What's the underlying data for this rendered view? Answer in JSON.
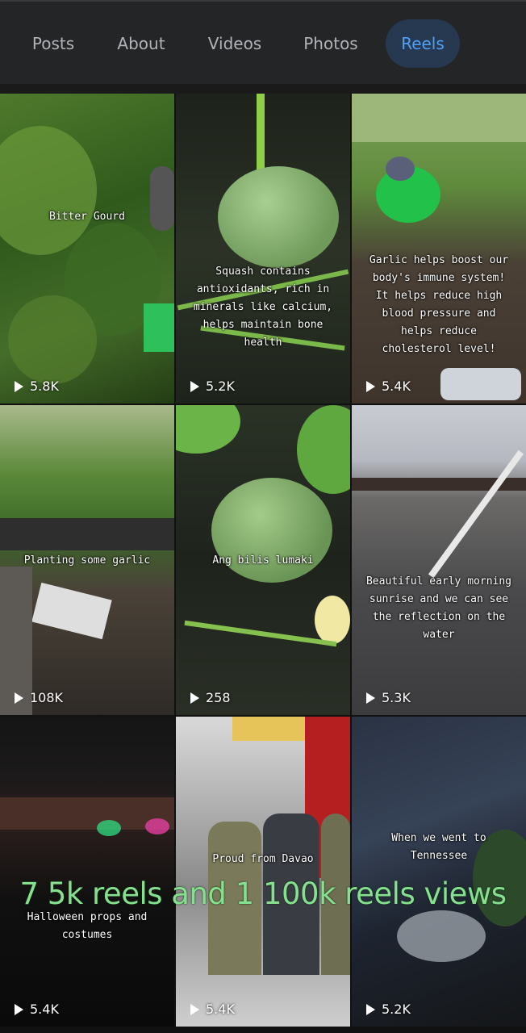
{
  "tabs": [
    {
      "label": "Posts",
      "active": false
    },
    {
      "label": "About",
      "active": false
    },
    {
      "label": "Videos",
      "active": false
    },
    {
      "label": "Photos",
      "active": false
    },
    {
      "label": "Reels",
      "active": true
    }
  ],
  "reels": [
    {
      "text": "Bitter Gourd",
      "views": "5.8K"
    },
    {
      "text": "Squash contains\nantioxidants, rich in\nminerals like calcium,\nhelps maintain bone\nhealth",
      "views": "5.2K"
    },
    {
      "text": "Garlic helps boost our\nbody's immune system!\nIt helps reduce high\nblood pressure and\nhelps reduce\ncholesterol level!",
      "views": "5.4K"
    },
    {
      "text": "Planting some garlic",
      "views": "108K"
    },
    {
      "text": "Ang bilis lumaki",
      "views": "258"
    },
    {
      "text": "Beautiful early morning\nsunrise and we can see\nthe reflection on the\nwater",
      "views": "5.3K"
    },
    {
      "text": "Halloween props and\ncostumes",
      "views": "5.4K"
    },
    {
      "text": "Proud from Davao",
      "views": "5.4K"
    },
    {
      "text": "When we went to\nTennessee",
      "views": "5.2K"
    }
  ],
  "overlay_caption": "7 5k reels and 1 100k reels views",
  "colors": {
    "active_tab_bg": "#263951",
    "active_tab_text": "#4ea1f5",
    "caption_green": "#86e08f"
  }
}
